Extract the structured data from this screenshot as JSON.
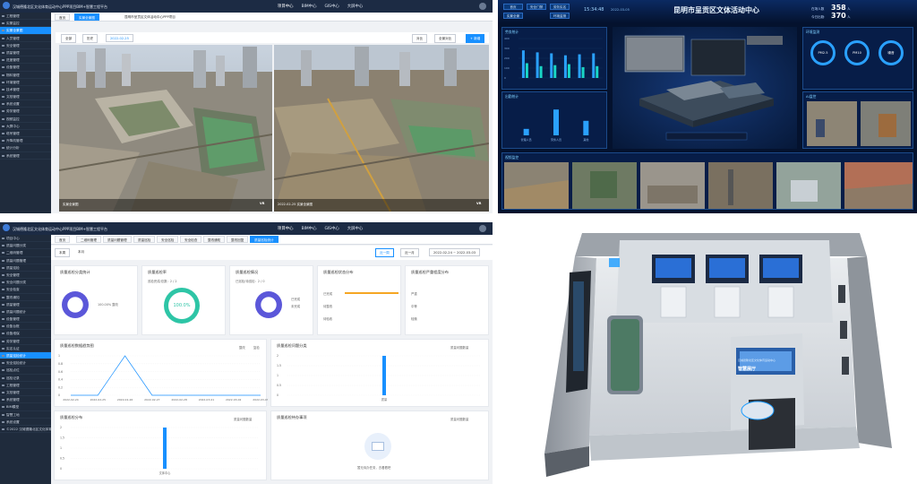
{
  "panel_a": {
    "brand": "汉城德隆北区文化体育运动中心PPP项目BIM+智慧工程平台",
    "nav": [
      "项目中心",
      "BIM中心",
      "GIS中心",
      "大屏中心"
    ],
    "tabs": [
      "首页",
      "实景全景图",
      "昆明市呈贡区文体活动中心PPP项目"
    ],
    "sidebar": [
      "工程管理",
      "实景监控",
      "实景全景图",
      "人员管理",
      "安全管理",
      "质量管理",
      "进度管理",
      "设备管理",
      "物料管理",
      "环境管理",
      "技术管理",
      "文档管理",
      "系统设置",
      "劳务管理",
      "视频监控",
      "大屏中心",
      "塔吊管理",
      "升降机管理",
      "统计分析",
      "系统管理"
    ],
    "toolbar": {
      "btn1": "全部",
      "btn2": "历史",
      "date": "2022-02-25",
      "right1": "对比",
      "right2": "全景对比",
      "right3": "+ 新增"
    },
    "photo_left_caption": "实景全景图",
    "photo_right_caption": "2022-02-25 实景全景图",
    "vr_label": "VR"
  },
  "panel_b": {
    "title": "昆明市呈贡区文体活动中心",
    "time": "15:34:48",
    "date": "2022-03-05",
    "top_buttons": [
      "首页",
      "安全门禁",
      "劳务实名",
      "实景全景",
      "环境监测"
    ],
    "stat1_label": "在场人数",
    "stat1_value": "358",
    "stat2_label": "今日出勤",
    "stat2_value": "370",
    "stat1_unit": "人",
    "stat2_unit": "人",
    "box_titles": [
      "劳务统计",
      "出勤统计",
      "环境监测",
      "AI监控",
      "视频监控"
    ],
    "gauges": [
      "PM2.5",
      "PM10",
      "噪音"
    ],
    "bar_values": [
      280,
      260,
      250,
      230,
      240,
      250
    ],
    "bar_values2": [
      150,
      120,
      130,
      140,
      110,
      120
    ],
    "ticks_y": [
      "400",
      "300",
      "200",
      "100",
      "0"
    ],
    "attendance_values": [
      20,
      80,
      45
    ],
    "attendance_labels": [
      "管理人员",
      "劳务人员",
      "其他"
    ]
  },
  "panel_c": {
    "brand": "汉城德隆北区文化体育运动中心PPP项目BIM+智慧工程平台",
    "nav": [
      "项目中心",
      "BIM中心",
      "GIS中心",
      "大屏中心"
    ],
    "tabs": [
      "首页",
      "二维码管理",
      "质量问题管理",
      "质量巡检",
      "安全巡检",
      "安全检查",
      "整改通知",
      "整改回复",
      "质量巡检统计"
    ],
    "filter": {
      "b1": "本周",
      "b2": "本月",
      "range1": "近一周",
      "range2": "近一月",
      "date_range": "2022-02-24 ~ 2022-03-03"
    },
    "sidebar": [
      "项目中心",
      "质量问题分类",
      "二维码管理",
      "质量问题管理",
      "质量巡检",
      "安全管理",
      "安全问题分类",
      "安全检查",
      "整改通知",
      "质量管理",
      "质量问题统计",
      "设备管理",
      "设备台账",
      "设备维保",
      "劳务管理",
      "实名认证",
      "质量巡检统计",
      "安全巡检统计",
      "巡检点位",
      "巡检记录",
      "工程管理",
      "文档管理",
      "系统管理",
      "BIM模型",
      "智慧工地",
      "系统设置",
      "©2022 汉城德隆北区文化体育"
    ],
    "cards": {
      "c1": {
        "title": "质量巡检分类统计",
        "legend": "100.00%  整改"
      },
      "c2": {
        "title": "质量巡检率",
        "sub": "巡检完成/总数：2 / 2",
        "center": "100.0%"
      },
      "c3": {
        "title": "质量巡检情况",
        "sub": "已巡检/待巡检：2 / 0",
        "l1": "已完成",
        "l2": "未完成"
      },
      "c4": {
        "title": "质量巡检状态分布",
        "rows": [
          "已完成",
          "待整改",
          "待验收"
        ]
      },
      "c5": {
        "title": "质量巡检严重程度分布",
        "rows": [
          "严重",
          "中等",
          "轻微"
        ]
      }
    },
    "chart1": {
      "title": "质量巡检数据趋势图",
      "legend1": "整改",
      "legend2": "复检",
      "y_ticks": [
        "1",
        "0.8",
        "0.6",
        "0.4",
        "0.2",
        "0"
      ],
      "x_labels": [
        "2022-02-24",
        "2022-02-25",
        "2022-02-26",
        "2022-02-27",
        "2022-02-28",
        "2022-03-01",
        "2022-03-02",
        "2022-03-03"
      ],
      "values": [
        0,
        0,
        1,
        0,
        0,
        0,
        0,
        0
      ]
    },
    "chart2": {
      "title": "质量巡检问题分类",
      "legend": "质量问题数量",
      "y_ticks": [
        "2",
        "1.5",
        "1",
        "0.5",
        "0"
      ],
      "label": "质量",
      "value": 2
    },
    "chart3": {
      "title": "质量巡检分布",
      "legend": "质量问题数量",
      "y_ticks": [
        "2",
        "1.5",
        "1",
        "0.5",
        "0"
      ],
      "label": "文体中心",
      "value": 2
    },
    "chart4": {
      "title": "质量巡检待办事项",
      "legend": "质量问题数量",
      "empty": "暂无待办任务，去看看吧"
    }
  },
  "panel_d": {
    "screen_label": "智慧展厅",
    "screen_sub": "汉城德隆北区文化体育运动中心"
  },
  "colors": {
    "accent": "#1890ff",
    "dark_nav": "#1c2b44",
    "sidebar": "#1f2b3c",
    "dash_bg": "#04122e",
    "purple": "#5b57d9",
    "teal": "#2ec5a6",
    "orange": "#f5a623"
  }
}
